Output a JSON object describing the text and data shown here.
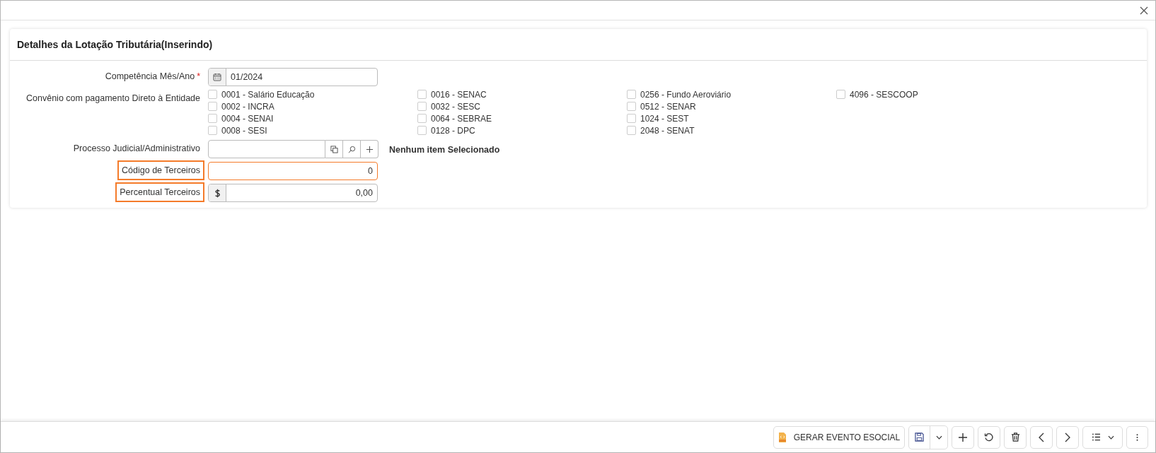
{
  "panel": {
    "title": "Detalhes da Lotação Tributária(Inserindo)"
  },
  "fields": [
    {
      "kind": "date",
      "label": "Competência Mês/Ano",
      "required_mark": "*",
      "value": "01/2024",
      "highlighted": false
    },
    {
      "kind": "checkboxes",
      "label": "Convênio com pagamento Direto à Entidade",
      "options": [
        {
          "label": "0001 - Salário Educação",
          "checked": false
        },
        {
          "label": "0002 - INCRA",
          "checked": false
        },
        {
          "label": "0004 - SENAI",
          "checked": false
        },
        {
          "label": "0008 - SESI",
          "checked": false
        },
        {
          "label": "0016 - SENAC",
          "checked": false
        },
        {
          "label": "0032 - SESC",
          "checked": false
        },
        {
          "label": "0064 - SEBRAE",
          "checked": false
        },
        {
          "label": "0128 - DPC",
          "checked": false
        },
        {
          "label": "0256 - Fundo Aeroviário",
          "checked": false
        },
        {
          "label": "0512 - SENAR",
          "checked": false
        },
        {
          "label": "1024 - SEST",
          "checked": false
        },
        {
          "label": "2048 - SENAT",
          "checked": false
        },
        {
          "label": "4096 - SESCOOP",
          "checked": false
        }
      ]
    },
    {
      "kind": "lookup",
      "label": "Processo Judicial/Administrativo",
      "note": "Nenhum item Selecionado"
    },
    {
      "kind": "number",
      "label": "Código de Terceiros",
      "value": "0",
      "highlighted": true
    },
    {
      "kind": "currency",
      "label": "Percentual Terceiros",
      "value": "0,00",
      "highlighted": true
    }
  ],
  "toolbar": [
    {
      "kind": "gerar",
      "label": "GERAR EVENTO ESOCIAL"
    },
    {
      "kind": "save"
    },
    {
      "kind": "add"
    },
    {
      "kind": "refresh"
    },
    {
      "kind": "delete"
    },
    {
      "kind": "prev"
    },
    {
      "kind": "next"
    },
    {
      "kind": "list"
    },
    {
      "kind": "more"
    }
  ]
}
